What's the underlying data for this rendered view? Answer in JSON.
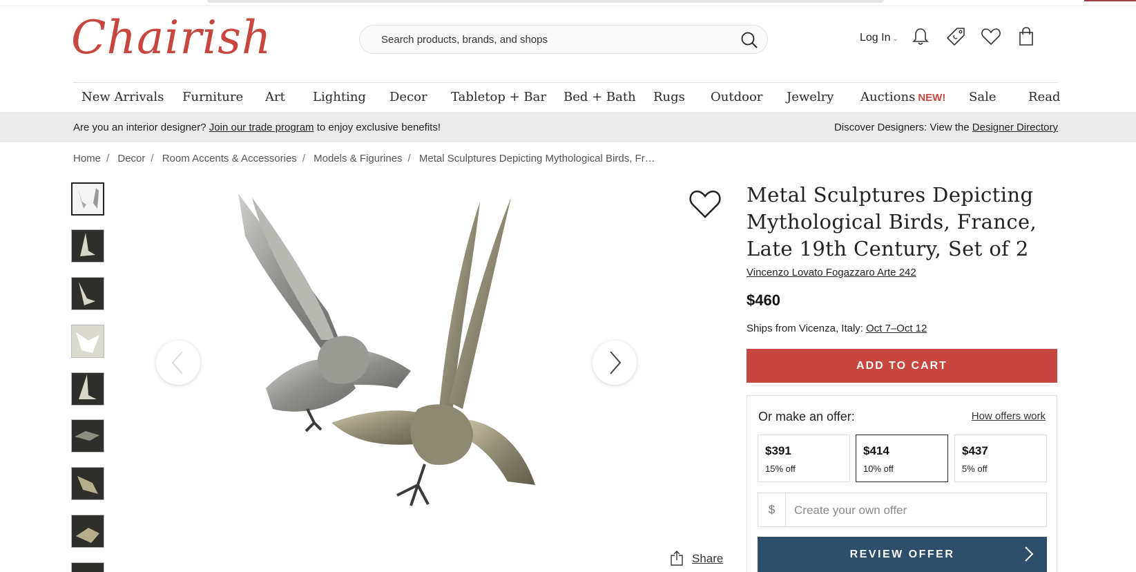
{
  "header": {
    "logo": "Chairish",
    "search_placeholder": "Search products, brands, and shops",
    "login_label": "Log In"
  },
  "nav": {
    "items": [
      "New Arrivals",
      "Furniture",
      "Art",
      "Lighting",
      "Decor",
      "Tabletop + Bar",
      "Bed + Bath",
      "Rugs",
      "Outdoor",
      "Jewelry",
      "Auctions",
      "Sale",
      "Read"
    ],
    "auctions_badge": "NEW!"
  },
  "promo": {
    "left_prefix": "Are you an interior designer?",
    "left_link": "Join our trade program",
    "left_suffix": "to enjoy exclusive benefits!",
    "right_prefix": "Discover Designers: View the",
    "right_link": "Designer Directory"
  },
  "breadcrumbs": [
    "Home",
    "Decor",
    "Room Accents & Accessories",
    "Models & Figurines",
    "Metal Sculptures Depicting Mythological Birds, Fr…"
  ],
  "product": {
    "title": "Metal Sculptures Depicting Mythological Birds, France, Late 19th Century, Set of 2",
    "seller": "Vincenzo Lovato Fogazzaro Arte 242",
    "price": "$460",
    "ships_prefix": "Ships from Vicenza, Italy:",
    "ships_dates": "Oct 7–Oct 12",
    "add_to_cart": "ADD TO CART",
    "share": "Share"
  },
  "offer": {
    "label": "Or make an offer:",
    "how": "How offers work",
    "options": [
      {
        "price": "$391",
        "off": "15% off"
      },
      {
        "price": "$414",
        "off": "10% off"
      },
      {
        "price": "$437",
        "off": "5% off"
      }
    ],
    "currency": "$",
    "own_placeholder": "Create your own offer",
    "review": "REVIEW OFFER"
  },
  "colors": {
    "brand": "#c7473e",
    "review_button": "#2d4e6a"
  }
}
